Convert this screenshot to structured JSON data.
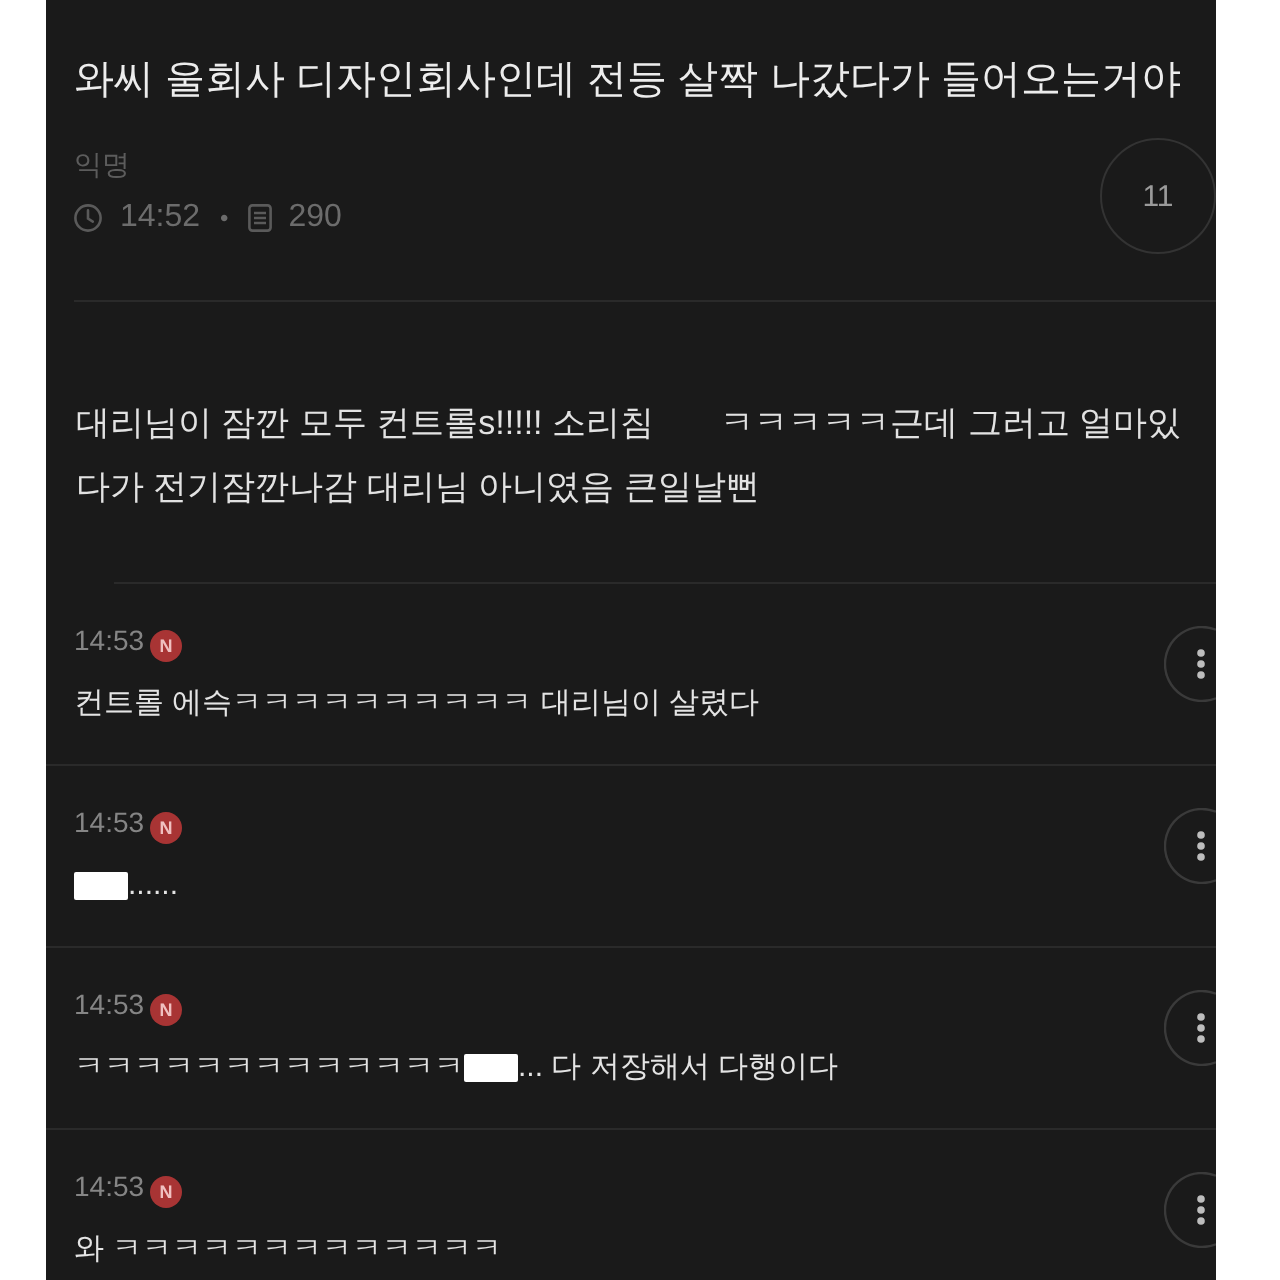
{
  "post": {
    "title": "와씨 울회사 디자인회사인데 전등 살짝 나갔다가 들어오는거야",
    "author": "익명",
    "time": "14:52",
    "separator": "•",
    "views": "290",
    "comment_count": "11",
    "body_lines": [
      "대리님이 잠깐 모두 컨트롤s!!!!! 소리침       ㅋㅋㅋㅋㅋ근데 그러고 얼마있",
      "다가 전기잠깐나감 대리님 아니였음 큰일날뻔"
    ]
  },
  "comments": [
    {
      "time": "14:53",
      "badge": "N",
      "segments": [
        {
          "kind": "text",
          "text": "컨트롤 에슥ㅋㅋㅋㅋㅋㅋㅋㅋㅋㅋ 대리님이 살렸다"
        }
      ]
    },
    {
      "time": "14:53",
      "badge": "N",
      "segments": [
        {
          "kind": "redaction"
        },
        {
          "kind": "text",
          "text": "......"
        }
      ]
    },
    {
      "time": "14:53",
      "badge": "N",
      "segments": [
        {
          "kind": "text",
          "text": "ㅋㅋㅋㅋㅋㅋㅋㅋㅋㅋㅋㅋㅋ"
        },
        {
          "kind": "redaction"
        },
        {
          "kind": "text",
          "text": "... 다 저장해서 다행이다"
        }
      ]
    },
    {
      "time": "14:53",
      "badge": "N",
      "segments": [
        {
          "kind": "text",
          "text": "와 ㅋㅋㅋㅋㅋㅋㅋㅋㅋㅋㅋㅋㅋ"
        }
      ]
    }
  ]
}
